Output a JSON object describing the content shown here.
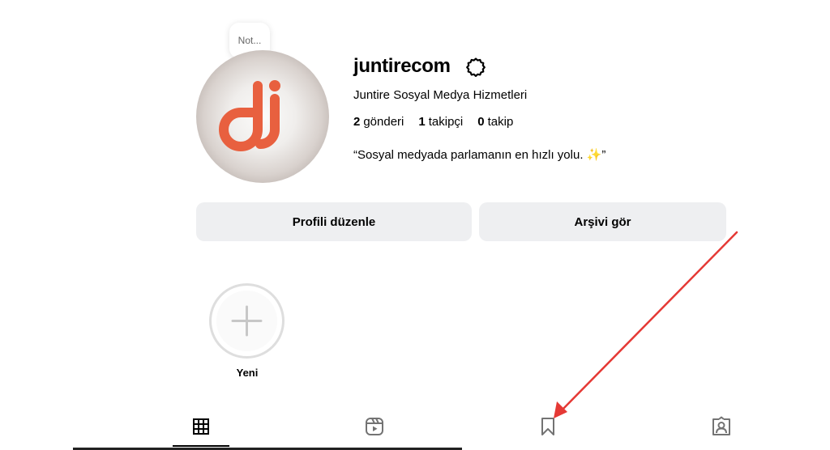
{
  "note": {
    "text": "Not..."
  },
  "profile": {
    "username": "juntirecom",
    "full_name": "Juntire Sosyal Medya Hizmetleri",
    "bio": "“Sosyal medyada parlamanın en hızlı yolu. ✨”",
    "avatar_icon": "juntire-dj-logo",
    "brand_color": "#E8603F"
  },
  "stats": {
    "posts_count": "2",
    "posts_label": "gönderi",
    "followers_count": "1",
    "followers_label": "takipçi",
    "following_count": "0",
    "following_label": "takip"
  },
  "buttons": {
    "edit_profile": "Profili düzenle",
    "view_archive": "Arşivi gör"
  },
  "highlights": {
    "new_label": "Yeni"
  },
  "tabs": [
    {
      "icon": "grid-icon",
      "active": true
    },
    {
      "icon": "reels-icon",
      "active": false
    },
    {
      "icon": "bookmark-icon",
      "active": false
    },
    {
      "icon": "tagged-icon",
      "active": false
    }
  ],
  "annotation": {
    "color": "#E53935",
    "points_to": "bookmark-icon"
  }
}
